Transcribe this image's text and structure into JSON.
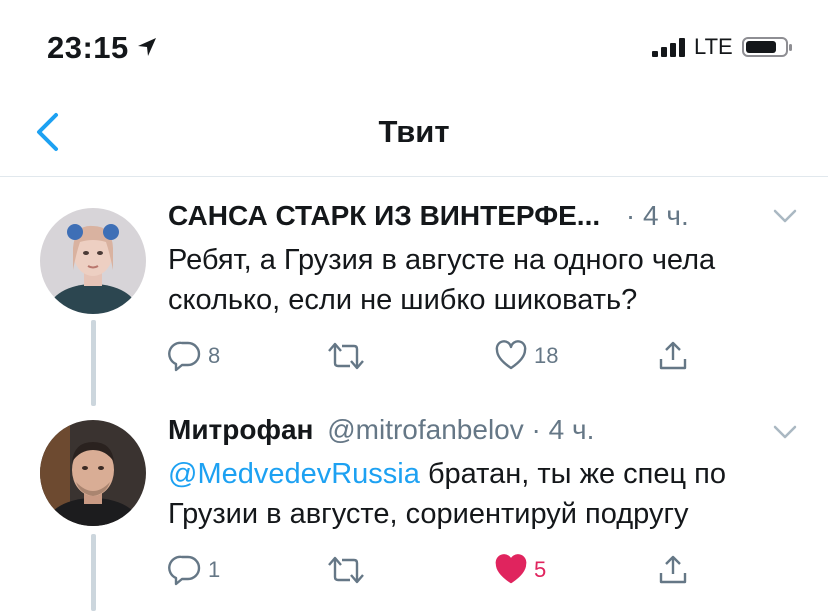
{
  "status_bar": {
    "time": "23:15",
    "network": "LTE",
    "icons": [
      "location-arrow-icon",
      "signal-bars-icon",
      "battery-icon"
    ]
  },
  "nav": {
    "title": "Твит",
    "back_icon": "chevron-left-icon"
  },
  "colors": {
    "accent": "#1da1f2",
    "like": "#e0245e",
    "secondary_text": "#657786",
    "divider": "#e1e8ed"
  },
  "tweets": [
    {
      "name": "САНСА СТАРК ИЗ ВИНТЕРФЕ...",
      "dot": "·",
      "age": "4 ч.",
      "text": "Ребят, а Грузия в августе на одного чела сколько, если не шибко шиковать?",
      "reply_count": "8",
      "retweet_count": "",
      "like_count": "18",
      "liked": false
    },
    {
      "name": "Митрофан",
      "handle": "@mitrofanbelov",
      "dot": "·",
      "age": "4 ч.",
      "mention": "@MedvedevRussia",
      "text": " братан, ты же спец по Грузии в августе, сориентируй подругу",
      "reply_count": "1",
      "retweet_count": "",
      "like_count": "5",
      "liked": true
    }
  ]
}
